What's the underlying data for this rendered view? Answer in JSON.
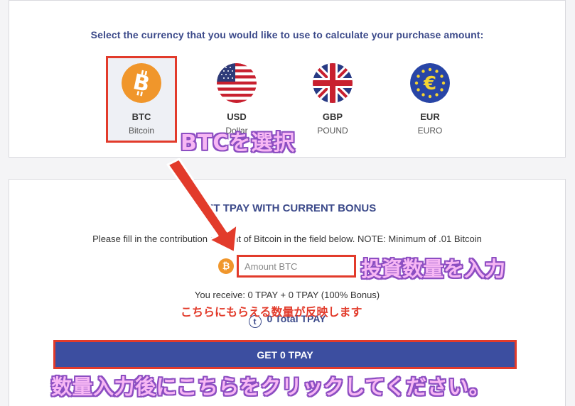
{
  "currency_panel": {
    "heading": "Select the currency that you would like to use to calculate your purchase amount:",
    "options": [
      {
        "code": "BTC",
        "name": "Bitcoin",
        "icon": "bitcoin-icon",
        "selected": true
      },
      {
        "code": "USD",
        "name": "Dollar",
        "icon": "us-flag-icon",
        "selected": false
      },
      {
        "code": "GBP",
        "name": "POUND",
        "icon": "uk-flag-icon",
        "selected": false
      },
      {
        "code": "EUR",
        "name": "EURO",
        "icon": "eu-flag-icon",
        "selected": false
      }
    ]
  },
  "purchase_panel": {
    "heading": "GET TPAY WITH CURRENT BONUS",
    "instruction": "Please fill in the contribution amount of Bitcoin in the field below. NOTE: Minimum of .01 Bitcoin",
    "amount_placeholder": "Amount BTC",
    "receive_text": "You receive: 0 TPAY + 0 TPAY (100% Bonus)",
    "total_text": "0 Total TPAY",
    "get_button": "GET 0 TPAY"
  },
  "annotations": {
    "select_btc": "BTCを選択",
    "enter_amount": "投資数量を入力",
    "reflect": "こちらにもらえる数量が反映します",
    "click_after": "数量入力後にこちらをクリックしてください。"
  },
  "colors": {
    "accent": "#3c4a8a",
    "button": "#3c4ea0",
    "highlight": "#e23b2b",
    "bitcoin": "#f0962b"
  }
}
